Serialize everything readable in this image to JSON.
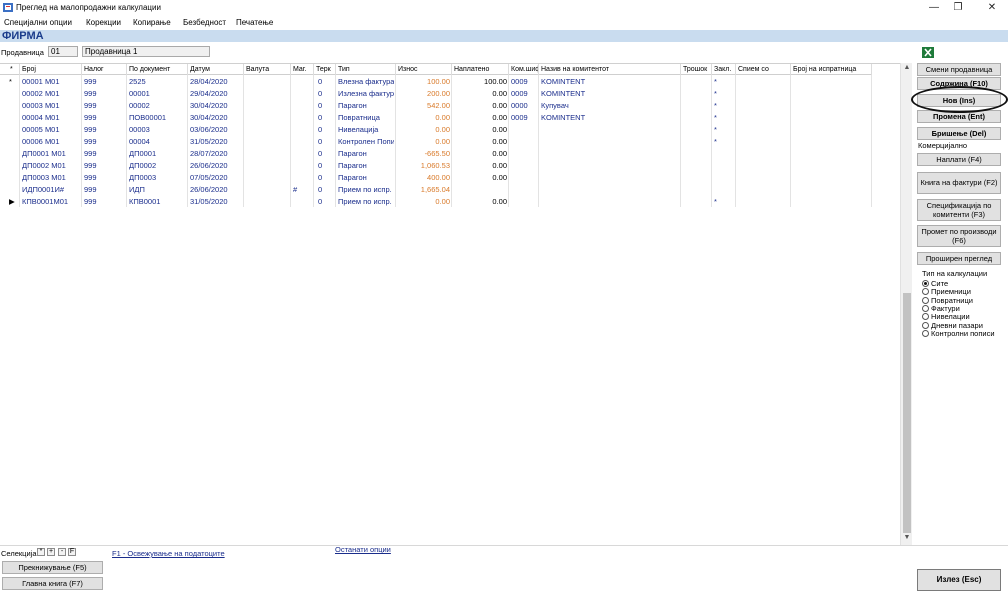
{
  "window": {
    "title": "Преглед на малопродажни калкулации",
    "controls": {
      "minimize": "—",
      "restore": "❐",
      "close": "✕"
    }
  },
  "menu": [
    "Специјални опции",
    "Корекции",
    "Копирање",
    "Безбедност",
    "Печатење"
  ],
  "company": {
    "name": "ФИРМА"
  },
  "store": {
    "label": "Продавница",
    "code": "01",
    "name": "Продавница 1"
  },
  "grid": {
    "columns": [
      "*",
      "Број",
      "Налог",
      "По документ",
      "Датум",
      "Валута",
      "Маг.",
      "Терк",
      "Тип",
      "Износ",
      "Наплатено",
      "Ком.шиф",
      "Назив на комитентот",
      "Трошок",
      "Закл.",
      "Спием со",
      "Број на испратница"
    ],
    "rows": [
      {
        "marker": "*",
        "broj": "00001  M01",
        "nalog": "999",
        "po_dok": "2525",
        "datum": "28/04/2020",
        "valuta": "",
        "mag": "",
        "terk": "0",
        "tip": "Влезна фактура",
        "iznos": "100.00",
        "naplateno": "100.00",
        "kom": "0009",
        "naziv": "KOMINTENT",
        "zakl": "*"
      },
      {
        "marker": "",
        "broj": "00002  M01",
        "nalog": "999",
        "po_dok": "00001",
        "datum": "29/04/2020",
        "valuta": "",
        "mag": "",
        "terk": "0",
        "tip": "Излезна фактура",
        "iznos": "200.00",
        "naplateno": "0.00",
        "kom": "0009",
        "naziv": "KOMINTENT",
        "zakl": "*"
      },
      {
        "marker": "",
        "broj": "00003  M01",
        "nalog": "999",
        "po_dok": "00002",
        "datum": "30/04/2020",
        "valuta": "",
        "mag": "",
        "terk": "0",
        "tip": "Парагон",
        "iznos": "542.00",
        "naplateno": "0.00",
        "kom": "0000",
        "naziv": "Купувач",
        "zakl": "*"
      },
      {
        "marker": "",
        "broj": "00004  M01",
        "nalog": "999",
        "po_dok": "ПОВ00001",
        "datum": "30/04/2020",
        "valuta": "",
        "mag": "",
        "terk": "0",
        "tip": "Повратница",
        "iznos": "0.00",
        "naplateno": "0.00",
        "kom": "0009",
        "naziv": "KOMINTENT",
        "zakl": "*"
      },
      {
        "marker": "",
        "broj": "00005  M01",
        "nalog": "999",
        "po_dok": "00003",
        "datum": "03/06/2020",
        "valuta": "",
        "mag": "",
        "terk": "0",
        "tip": "Нивелација",
        "iznos": "0.00",
        "naplateno": "0.00",
        "kom": "",
        "naziv": "",
        "zakl": "*"
      },
      {
        "marker": "",
        "broj": "00006  M01",
        "nalog": "999",
        "po_dok": "00004",
        "datum": "31/05/2020",
        "valuta": "",
        "mag": "",
        "terk": "0",
        "tip": "Контролен Попис",
        "iznos": "0.00",
        "naplateno": "0.00",
        "kom": "",
        "naziv": "",
        "zakl": "*"
      },
      {
        "marker": "",
        "broj": "ДП0001 M01",
        "nalog": "999",
        "po_dok": "ДП0001",
        "datum": "28/07/2020",
        "valuta": "",
        "mag": "",
        "terk": "0",
        "tip": "Парагон",
        "iznos": "-665.50",
        "naplateno": "0.00",
        "kom": "",
        "naziv": "",
        "zakl": ""
      },
      {
        "marker": "",
        "broj": "ДП0002 M01",
        "nalog": "999",
        "po_dok": "ДП0002",
        "datum": "26/06/2020",
        "valuta": "",
        "mag": "",
        "terk": "0",
        "tip": "Парагон",
        "iznos": "1,060.53",
        "naplateno": "0.00",
        "kom": "",
        "naziv": "",
        "zakl": ""
      },
      {
        "marker": "",
        "broj": "ДП0003 M01",
        "nalog": "999",
        "po_dok": "ДП0003",
        "datum": "07/05/2020",
        "valuta": "",
        "mag": "",
        "terk": "0",
        "tip": "Парагон",
        "iznos": "400.00",
        "naplateno": "0.00",
        "kom": "",
        "naziv": "",
        "zakl": ""
      },
      {
        "marker": "",
        "broj": "ИДП0001И#",
        "nalog": "999",
        "po_dok": "ИДП",
        "datum": "26/06/2020",
        "valuta": "",
        "mag": "#",
        "terk": "0",
        "tip": "Прием по испр.",
        "iznos": "1,665.04",
        "naplateno": "",
        "kom": "",
        "naziv": "",
        "zakl": ""
      },
      {
        "marker": "▶",
        "broj": "КПВ0001M01",
        "nalog": "999",
        "po_dok": "КПВ0001",
        "datum": "31/05/2020",
        "valuta": "",
        "mag": "",
        "terk": "0",
        "tip": "Прием по испр.",
        "iznos": "0.00",
        "naplateno": "0.00",
        "kom": "",
        "naziv": "",
        "zakl": "*"
      }
    ]
  },
  "right_panel": {
    "change_store": "Смени продавница",
    "content": "Содржина (F10)",
    "new": "Нов (Ins)",
    "edit": "Промена (Ent)",
    "delete": "Бришење (Del)",
    "commercial_label": "Комерцијално",
    "payments": "Наплати (F4)",
    "invoice_book": "Книга на фактури (F2)",
    "spec_by_client": "Спецификација по комитенти (F3)",
    "turnover_by_product": "Промет по производи (F6)",
    "extended_view": "Проширен преглед",
    "calc_type_label": "Тип на калкулации",
    "calc_types": [
      "Сите",
      "Приемници",
      "Повратници",
      "Фактури",
      "Нивелации",
      "Дневни пазари",
      "Контролни пописи"
    ],
    "calc_type_selected": 0
  },
  "bottom": {
    "selection_label": "Селекција",
    "selection_buttons": [
      "*",
      "+",
      "-",
      "F"
    ],
    "refresh_link": "F1 - Освежување на податоците",
    "other_options_link": "Останати опции",
    "renumber_button": "Прекнижување (F5)",
    "ledger_button": "Главна книга (F7)",
    "exit_button": "Излез (Esc)"
  }
}
